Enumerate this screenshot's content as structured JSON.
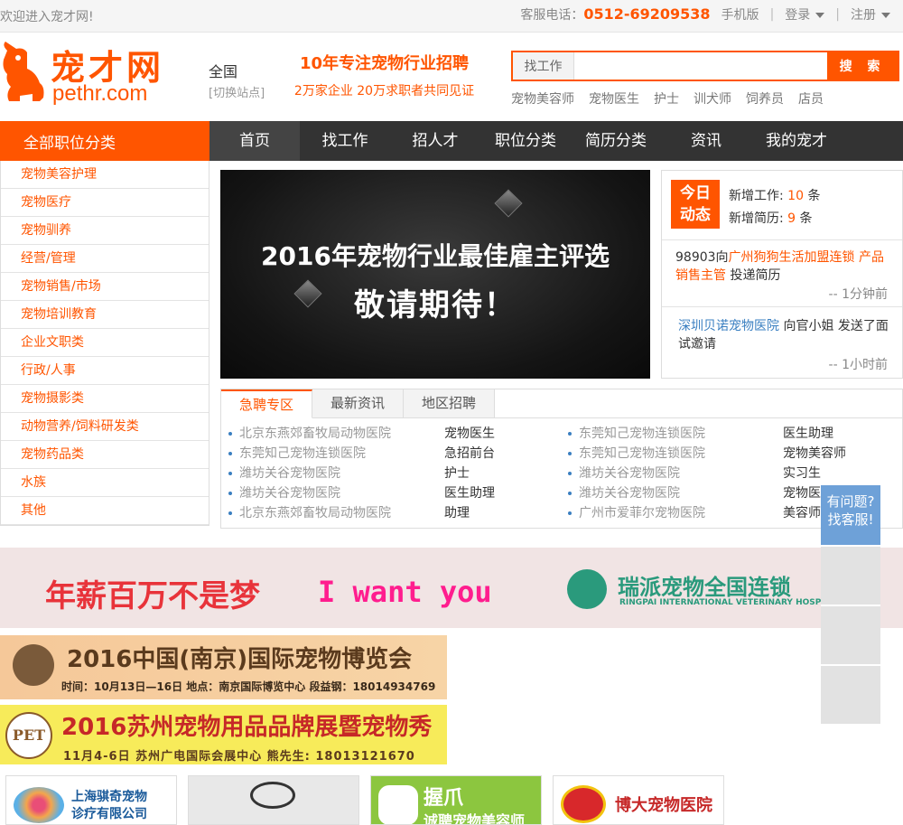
{
  "topbar": {
    "welcome": "欢迎进入宠才网!",
    "hotline_label": "客服电话：",
    "hotline_number": "0512-69209538",
    "mobile": "手机版",
    "login": "登录",
    "register": "注册"
  },
  "header": {
    "logo_cn": "宠才网",
    "logo_en": "pethr.com",
    "region_name": "全国",
    "region_switch": "[切换站点]",
    "slogan_line1": "10年专注宠物行业招聘",
    "slogan_line2": "2万家企业 20万求职者共同见证",
    "search_type": "找工作",
    "search_value": "",
    "search_button": "搜 索",
    "hot_keywords": [
      "宠物美容师",
      "宠物医生",
      "护士",
      "训犬师",
      "饲养员",
      "店员"
    ]
  },
  "nav": {
    "all_categories": "全部职位分类",
    "items": [
      "首页",
      "找工作",
      "招人才",
      "职位分类",
      "简历分类",
      "资讯",
      "我的宠才"
    ]
  },
  "sidebar": {
    "categories": [
      "宠物美容护理",
      "宠物医疗",
      "宠物驯养",
      "经营/管理",
      "宠物销售/市场",
      "宠物培训教育",
      "企业文职类",
      "行政/人事",
      "宠物摄影类",
      "动物营养/饲料研发类",
      "宠物药品类",
      "水族",
      "其他"
    ]
  },
  "banner": {
    "line1": "2016年宠物行业最佳雇主评选",
    "line2": "敬请期待！"
  },
  "today": {
    "badge_line1": "今日",
    "badge_line2": "动态",
    "new_jobs_label": "新增工作:",
    "new_jobs_count": "10",
    "new_jobs_unit": "条",
    "new_resumes_label": "新增简历:",
    "new_resumes_count": "9",
    "new_resumes_unit": "条",
    "event1_prefix": "98903向",
    "event1_company": "广州狗狗生活加盟连锁",
    "event1_position": "产品销售主管",
    "event1_suffix": "投递简历",
    "event1_time": "-- 1分钟前",
    "event2_company": "深圳贝诺宠物医院",
    "event2_text": "向官小姐 发送了面试邀请",
    "event2_time": "-- 1小时前"
  },
  "tabs": {
    "labels": [
      "急聘专区",
      "最新资讯",
      "地区招聘"
    ],
    "rows_left": [
      {
        "company": "北京东燕郊畜牧局动物医院",
        "position": "宠物医生"
      },
      {
        "company": "东莞知己宠物连锁医院",
        "position": "急招前台"
      },
      {
        "company": "潍坊关谷宠物医院",
        "position": "护士"
      },
      {
        "company": "潍坊关谷宠物医院",
        "position": "医生助理"
      },
      {
        "company": "北京东燕郊畜牧局动物医院",
        "position": "助理"
      }
    ],
    "rows_right": [
      {
        "company": "东莞知己宠物连锁医院",
        "position": "医生助理"
      },
      {
        "company": "东莞知己宠物连锁医院",
        "position": "宠物美容师"
      },
      {
        "company": "潍坊关谷宠物医院",
        "position": "实习生"
      },
      {
        "company": "潍坊关谷宠物医院",
        "position": "宠物医生"
      },
      {
        "company": "广州市爱菲尔宠物医院",
        "position": "美容师"
      }
    ]
  },
  "ad": {
    "slogan": "年薪百万不是梦",
    "want": "I want you",
    "brand": "瑞派宠物全国连锁",
    "brand_en": "RINGPAI INTERNATIONAL VETERINARY HOSPITAL"
  },
  "expo1": {
    "title": "2016中国(南京)国际宠物博览会",
    "sub": "时间：10月13日—16日  地点：南京国际博览中心  段益钢：18014934769"
  },
  "expo2": {
    "badge": "PET",
    "title": "2016苏州宠物用品品牌展暨宠物秀",
    "sub": "11月4-6日   苏州广电国际会展中心   熊先生: 18013121670"
  },
  "logos": {
    "l1_line1": "上海骐奇宠物",
    "l1_line2": "诊疗有限公司",
    "l3_line1": "握爪",
    "l3_line2": "诚聘宠物美容师",
    "l4": "博大宠物医院"
  },
  "help": {
    "line1": "有问题?",
    "line2": "找客服!"
  }
}
